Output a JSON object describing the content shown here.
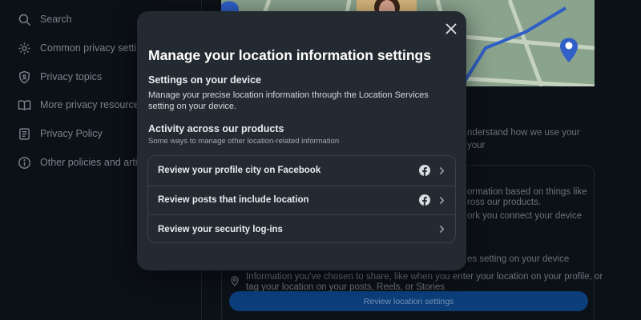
{
  "sidebar": {
    "items": [
      {
        "label": "Search",
        "icon": "search-icon"
      },
      {
        "label": "Common privacy settings",
        "icon": "gear-icon"
      },
      {
        "label": "Privacy topics",
        "icon": "shield-icon"
      },
      {
        "label": "More privacy resources",
        "icon": "book-icon"
      },
      {
        "label": "Privacy Policy",
        "icon": "document-icon"
      },
      {
        "label": "Other policies and articles",
        "icon": "info-icon"
      }
    ]
  },
  "background": {
    "understand_text": "nderstand how we use your",
    "your_text": "your",
    "info_text_1": "ormation based on things like",
    "info_text_2": "ross our products.",
    "network_text": "ork you connect your device",
    "device_text": "es setting on your device",
    "shared_text_1": "Information you've chosen to share, like when you enter your location on your profile, or",
    "shared_text_2": "tag your location on your posts, Reels, or Stories",
    "button_label": "Review location settings"
  },
  "modal": {
    "title": "Manage your location information settings",
    "device_section": {
      "title": "Settings on your device",
      "description": "Manage your precise location information through the Location Services setting on your device."
    },
    "activity_section": {
      "title": "Activity across our products",
      "subtitle": "Some ways to manage other location-related information"
    },
    "options": [
      {
        "label": "Review your profile city on Facebook",
        "icon": "facebook-icon"
      },
      {
        "label": "Review posts that include location",
        "icon": "facebook-icon"
      },
      {
        "label": "Review your security log-ins",
        "icon": ""
      }
    ]
  },
  "colors": {
    "background": "#0c1117",
    "modal": "#242a31",
    "accent_button": "#0c3e7a",
    "map_pin": "#2f5fc7"
  }
}
